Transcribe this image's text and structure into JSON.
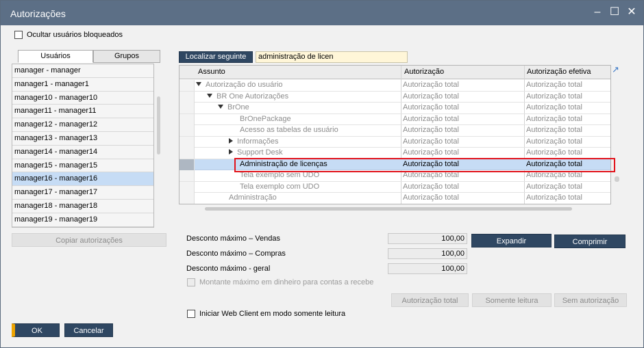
{
  "window": {
    "title": "Autorizações"
  },
  "options": {
    "hide_blocked_users": "Ocultar usuários bloqueados",
    "web_client_readonly": "Iniciar Web Client em modo somente leitura"
  },
  "tabs": [
    {
      "label": "Usuários"
    },
    {
      "label": "Grupos"
    }
  ],
  "users": [
    "manager - manager",
    "manager1 - manager1",
    "manager10 - manager10",
    "manager11 - manager11",
    "manager12 - manager12",
    "manager13 - manager13",
    "manager14 - manager14",
    "manager15 - manager15",
    "manager16 - manager16",
    "manager17 - manager17",
    "manager18 - manager18",
    "manager19 - manager19"
  ],
  "selected_user": "manager16 - manager16",
  "buttons": {
    "copy_auth": "Copiar autorizações",
    "find_next": "Localizar seguinte",
    "expand": "Expandir",
    "collapse": "Comprimir",
    "full_auth": "Autorização total",
    "read_only": "Somente leitura",
    "no_auth": "Sem autorização",
    "ok": "OK",
    "cancel": "Cancelar"
  },
  "search": {
    "value": "administração de licen"
  },
  "grid": {
    "headers": {
      "subject": "Assunto",
      "auth": "Autorização",
      "effective": "Autorização efetiva"
    },
    "rows": [
      {
        "subject": "Autorização do usuário",
        "auth": "Autorização total",
        "effective": "Autorização total",
        "toggle": "expanded"
      },
      {
        "subject": "BR One Autorizações",
        "auth": "Autorização total",
        "effective": "Autorização total",
        "toggle": "expanded"
      },
      {
        "subject": "BrOne",
        "auth": "Autorização total",
        "effective": "Autorização total",
        "toggle": "expanded"
      },
      {
        "subject": "BrOnePackage",
        "auth": "Autorização total",
        "effective": "Autorização total",
        "toggle": "none"
      },
      {
        "subject": "Acesso as tabelas de usuário",
        "auth": "Autorização total",
        "effective": "Autorização total",
        "toggle": "none"
      },
      {
        "subject": "Informações",
        "auth": "Autorização total",
        "effective": "Autorização total",
        "toggle": "collapsed"
      },
      {
        "subject": "Support Desk",
        "auth": "Autorização total",
        "effective": "Autorização total",
        "toggle": "collapsed"
      },
      {
        "subject": "Administração de licenças",
        "auth": "Autorização total",
        "effective": "Autorização total",
        "toggle": "none",
        "selected": true
      },
      {
        "subject": "Tela exemplo sem UDO",
        "auth": "Autorização total",
        "effective": "Autorização total",
        "toggle": "none"
      },
      {
        "subject": "Tela exemplo com UDO",
        "auth": "Autorização total",
        "effective": "Autorização total",
        "toggle": "none"
      },
      {
        "subject": "Administração",
        "auth": "Autorização total",
        "effective": "Autorização total",
        "toggle": "none"
      }
    ]
  },
  "discounts": {
    "sales_label": "Desconto máximo – Vendas",
    "sales_value": "100,00",
    "purchases_label": "Desconto máximo – Compras",
    "purchases_value": "100,00",
    "general_label": "Desconto máximo - geral",
    "general_value": "100,00"
  },
  "cash_max_label": "Montante máximo em dinheiro para contas a recebe",
  "colors": {
    "titlebar": "#5c6f86",
    "dark_button": "#2f4762",
    "selection": "#c6dcf5",
    "highlight_border": "#e2121a",
    "ok_accent": "#f0a500"
  }
}
